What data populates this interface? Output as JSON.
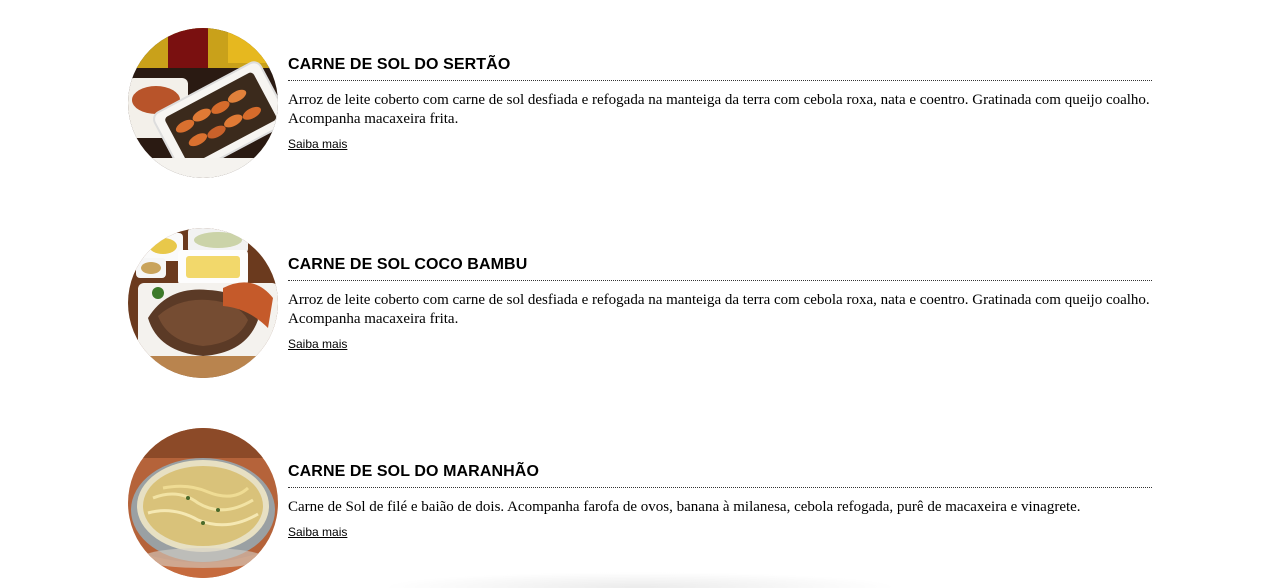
{
  "menu": {
    "items": [
      {
        "title": "CARNE DE SOL DO SERTÃO",
        "description": "Arroz de leite coberto com carne de sol desfiada e refogada na manteiga da terra com cebola roxa, nata e coentro. Gratinada com queijo coalho. Acompanha macaxeira frita.",
        "link": "Saiba mais",
        "image_icon": "shrimp-dish-photo"
      },
      {
        "title": "CARNE DE SOL COCO BAMBU",
        "description": "Arroz de leite coberto com carne de sol desfiada e refogada na manteiga da terra com cebola roxa, nata e coentro. Gratinada com queijo coalho. Acompanha macaxeira frita.",
        "link": "Saiba mais",
        "image_icon": "grilled-steak-photo"
      },
      {
        "title": "CARNE DE SOL DO MARANHÃO",
        "description": "Carne de Sol de filé e baião de dois. Acompanha farofa de ovos, banana à milanesa, cebola refogada, purê de macaxeira e vinagrete.",
        "link": "Saiba mais",
        "image_icon": "pasta-pan-photo"
      }
    ]
  }
}
